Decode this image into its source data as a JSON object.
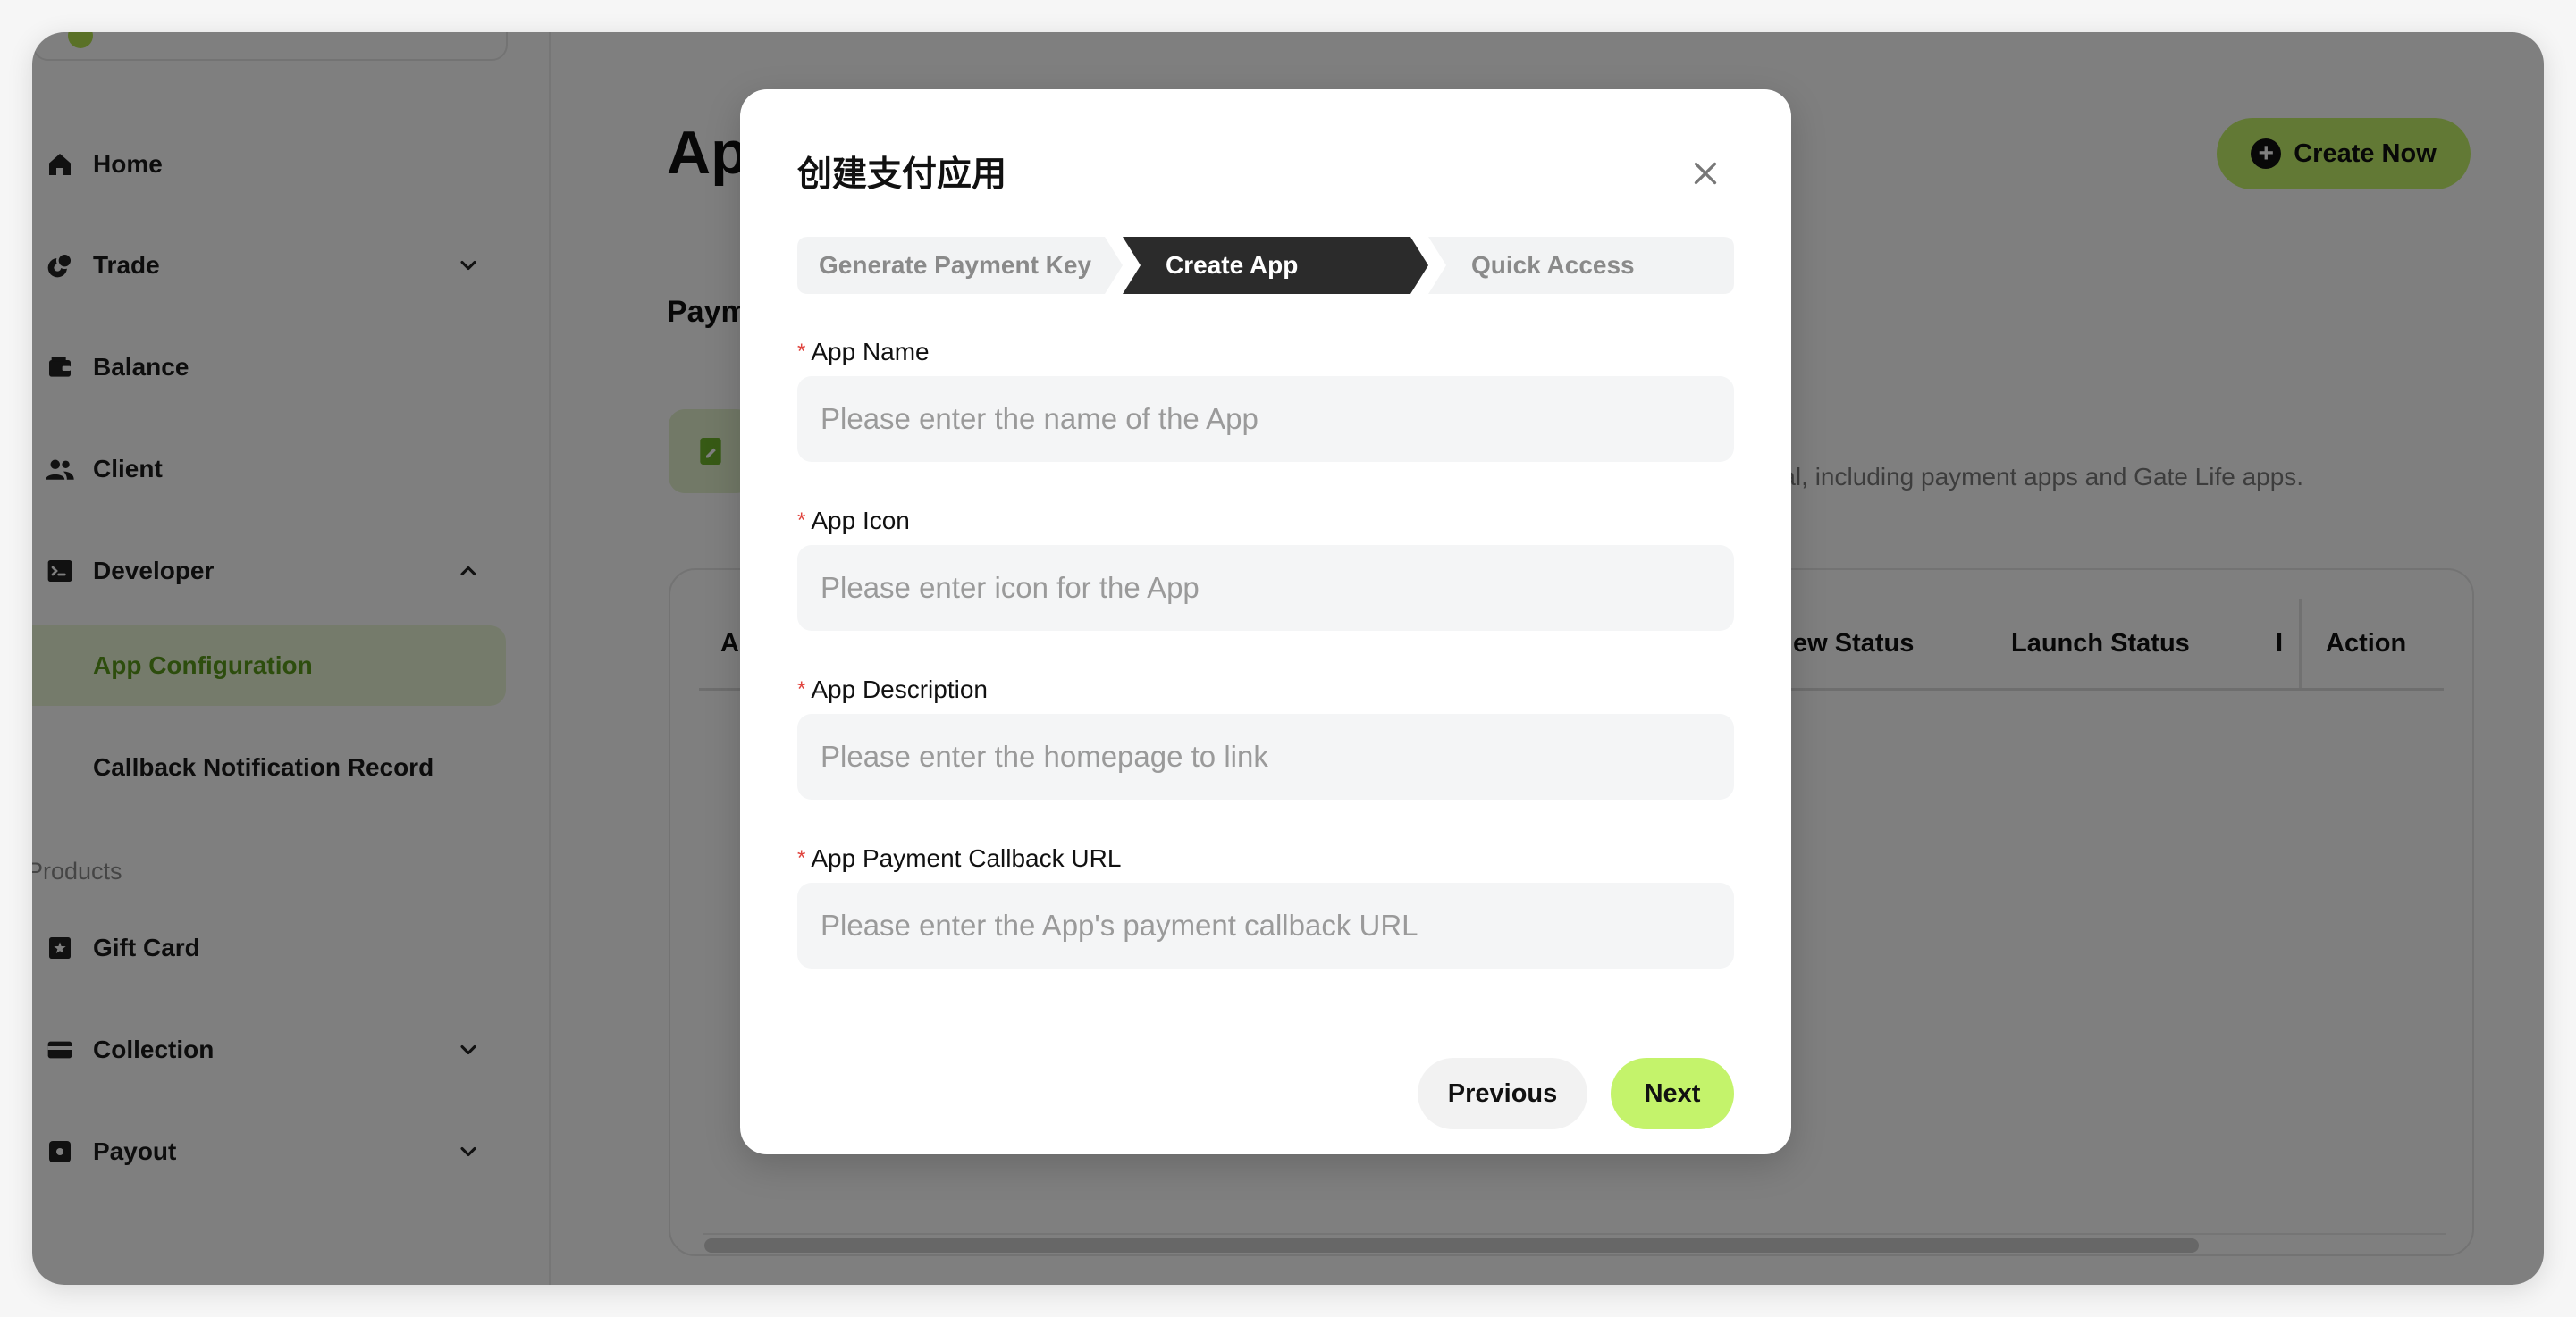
{
  "sidebar": {
    "items": [
      {
        "label": "Home",
        "icon": "home-icon"
      },
      {
        "label": "Trade",
        "icon": "trade-icon"
      },
      {
        "label": "Balance",
        "icon": "wallet-icon"
      },
      {
        "label": "Client",
        "icon": "users-icon"
      },
      {
        "label": "Developer",
        "icon": "terminal-icon"
      }
    ],
    "developer_sub": [
      {
        "label": "App Configuration"
      },
      {
        "label": "Callback Notification Record"
      }
    ],
    "products_label": "Products",
    "products": [
      {
        "label": "Gift Card",
        "icon": "gift-card-icon"
      },
      {
        "label": "Collection",
        "icon": "card-icon"
      },
      {
        "label": "Payout",
        "icon": "payout-icon"
      }
    ]
  },
  "main": {
    "title": "App",
    "create_button": "Create Now",
    "section_title": "Payme",
    "description_fragment": "otal, including payment apps and Gate Life apps.",
    "table_headers": {
      "app": "App",
      "review_status": "ew Status",
      "launch_status": "Launch Status",
      "partial": "I",
      "action": "Action"
    }
  },
  "modal": {
    "title": "创建支付应用",
    "steps": [
      "Generate Payment Key",
      "Create App",
      "Quick Access"
    ],
    "active_step": 1,
    "fields": [
      {
        "label": "App Name",
        "placeholder": "Please enter the name of the App",
        "value": ""
      },
      {
        "label": "App Icon",
        "placeholder": "Please enter icon for the App",
        "value": ""
      },
      {
        "label": "App Description",
        "placeholder": "Please enter the homepage to link",
        "value": ""
      },
      {
        "label": "App Payment Callback URL",
        "placeholder": "Please enter the App's payment callback URL",
        "value": ""
      }
    ],
    "required_mark": "*",
    "previous_button": "Previous",
    "next_button": "Next"
  },
  "colors": {
    "accent": "#c4f36b",
    "accent_dark_text": "#5b9a1a",
    "active_step_bg": "#2b2b2b",
    "required": "#e0443e",
    "overlay": "rgba(0,0,0,0.50)"
  }
}
